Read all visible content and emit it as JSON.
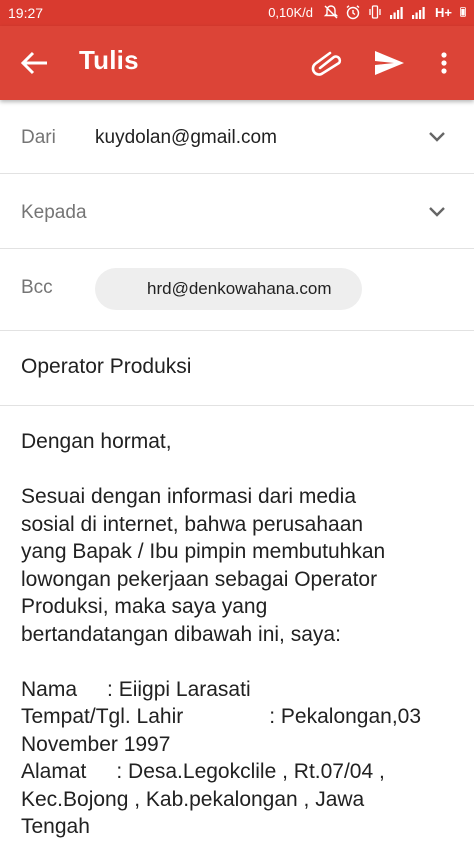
{
  "status_bar": {
    "time": "19:27",
    "speed": "0,10K/d",
    "network": "H+",
    "icons": [
      "mute-icon",
      "alarm-icon",
      "vibrate-icon",
      "signal-icon",
      "signal-icon",
      "battery-icon"
    ]
  },
  "app_bar": {
    "title": "Tulis",
    "icons": [
      "back-arrow-icon",
      "attach-icon",
      "send-icon",
      "more-vert-icon"
    ],
    "color": "#dc4437"
  },
  "compose": {
    "from_label": "Dari",
    "from_value": "kuydolan@gmail.com",
    "to_label": "Kepada",
    "to_value": "",
    "bcc_label": "Bcc",
    "bcc_chip": "hrd@denkowahana.com",
    "subject": "Operator Produksi"
  },
  "body": {
    "greeting": "Dengan hormat,",
    "para1_lines": [
      "Sesuai dengan informasi dari media",
      "sosial di internet, bahwa perusahaan",
      "yang Bapak / Ibu pimpin membutuhkan",
      "lowongan pekerjaan sebagai Operator",
      "Produksi, maka saya yang",
      "bertandatangan dibawah ini, saya:"
    ],
    "nama_label": "Nama",
    "nama_value": ": Eiigpi Larasati",
    "ttl_label": "Tempat/Tgl. Lahir",
    "ttl_value": ": Pekalongan,03",
    "ttl_cont": "November 1997",
    "alamat_label": "Alamat",
    "alamat_value": ": Desa.Legokclile , Rt.07/04 ,",
    "alamat_cont1": "Kec.Bojong , Kab.pekalongan , Jawa",
    "alamat_cont2": "Tengah"
  }
}
